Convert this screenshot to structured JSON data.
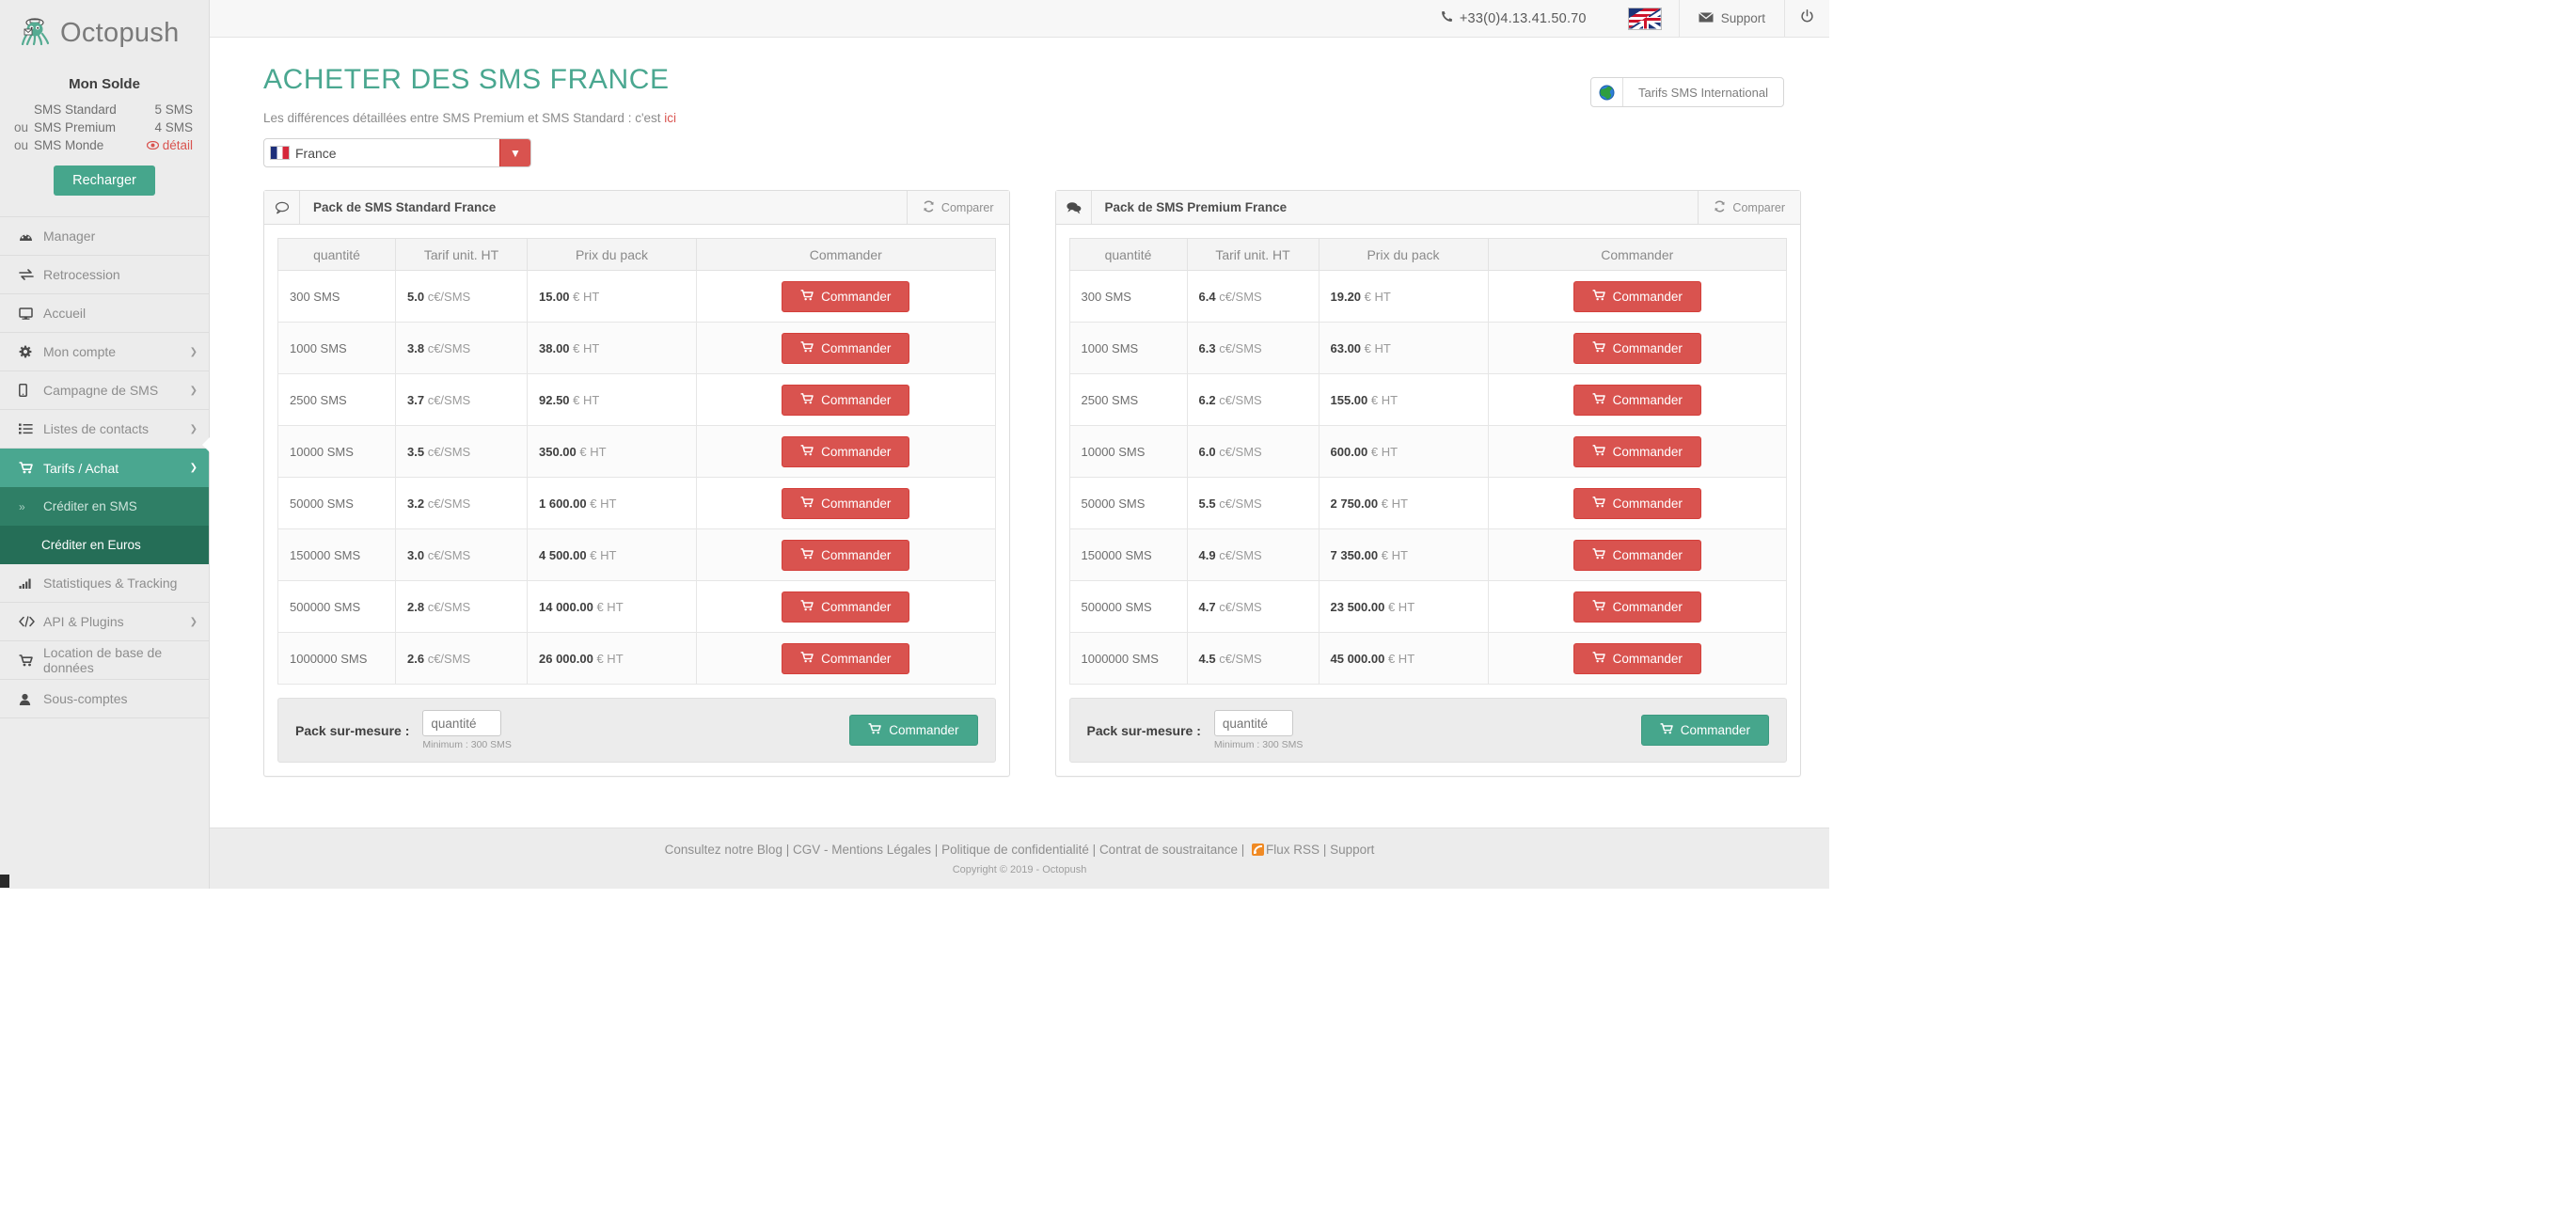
{
  "topbar": {
    "phone": "+33(0)4.13.41.50.70",
    "support_label": "Support",
    "phone_icon": "phone-icon",
    "flag_icon": "uk-us-flag-icon",
    "mail_icon": "mail-icon",
    "power_icon": "power-icon"
  },
  "brand": {
    "name": "Octopush",
    "logo_icon": "octopus-logo-icon"
  },
  "balance": {
    "title": "Mon Solde",
    "rows": [
      {
        "prefix": "",
        "label": "SMS Standard",
        "value": "5 SMS"
      },
      {
        "prefix": "ou",
        "label": "SMS Premium",
        "value": "4 SMS"
      },
      {
        "prefix": "ou",
        "label": "SMS Monde",
        "value": "détail"
      }
    ],
    "detail_label": "détail",
    "recharge_label": "Recharger"
  },
  "sidebar": {
    "items": [
      {
        "label": "Manager",
        "icon": "dashboard-icon",
        "caret": false
      },
      {
        "label": "Retrocession",
        "icon": "exchange-icon",
        "caret": false
      },
      {
        "label": "Accueil",
        "icon": "desktop-icon",
        "caret": false
      },
      {
        "label": "Mon compte",
        "icon": "gear-icon",
        "caret": true
      },
      {
        "label": "Campagne de SMS",
        "icon": "mobile-icon",
        "caret": true
      },
      {
        "label": "Listes de contacts",
        "icon": "list-icon",
        "caret": true
      },
      {
        "label": "Tarifs / Achat",
        "icon": "cart-icon",
        "caret": true,
        "active": true
      },
      {
        "label": "Statistiques & Tracking",
        "icon": "bar-chart-icon",
        "caret": false
      },
      {
        "label": "API & Plugins",
        "icon": "code-icon",
        "caret": true
      },
      {
        "label": "Location de base de données",
        "icon": "cart-icon",
        "caret": false
      },
      {
        "label": "Sous-comptes",
        "icon": "user-icon",
        "caret": false
      }
    ],
    "subitems": [
      {
        "label": "Créditer en SMS",
        "icon": "chevron-double-right-icon",
        "current": false
      },
      {
        "label": "Créditer en Euros",
        "icon": "",
        "current": true
      }
    ]
  },
  "header": {
    "title": "ACHETER DES SMS FRANCE",
    "subtitle_prefix": "Les différences détaillées entre SMS Premium et SMS Standard : c'est ",
    "subtitle_link": "ici",
    "international_button": "Tarifs SMS International",
    "globe_icon": "globe-icon"
  },
  "country_select": {
    "value": "France",
    "flag_icon": "france-flag-icon",
    "arrow_icon": "chevron-down-icon"
  },
  "panels": [
    {
      "icon": "speech-bubble-icon",
      "title": "Pack de SMS Standard France",
      "compare_label": "Comparer",
      "compare_icon": "refresh-icon",
      "columns": [
        "quantité",
        "Tarif unit. HT",
        "Prix du pack",
        "Commander"
      ],
      "order_label": "Commander",
      "cart_icon": "cart-icon",
      "rows": [
        {
          "qty": "300 SMS",
          "unit_value": "5.0",
          "unit_suffix": "c€/SMS",
          "price_value": "15.00",
          "price_suffix": "€ HT"
        },
        {
          "qty": "1000 SMS",
          "unit_value": "3.8",
          "unit_suffix": "c€/SMS",
          "price_value": "38.00",
          "price_suffix": "€ HT"
        },
        {
          "qty": "2500 SMS",
          "unit_value": "3.7",
          "unit_suffix": "c€/SMS",
          "price_value": "92.50",
          "price_suffix": "€ HT"
        },
        {
          "qty": "10000 SMS",
          "unit_value": "3.5",
          "unit_suffix": "c€/SMS",
          "price_value": "350.00",
          "price_suffix": "€ HT"
        },
        {
          "qty": "50000 SMS",
          "unit_value": "3.2",
          "unit_suffix": "c€/SMS",
          "price_value": "1 600.00",
          "price_suffix": "€ HT"
        },
        {
          "qty": "150000 SMS",
          "unit_value": "3.0",
          "unit_suffix": "c€/SMS",
          "price_value": "4 500.00",
          "price_suffix": "€ HT"
        },
        {
          "qty": "500000 SMS",
          "unit_value": "2.8",
          "unit_suffix": "c€/SMS",
          "price_value": "14 000.00",
          "price_suffix": "€ HT"
        },
        {
          "qty": "1000000 SMS",
          "unit_value": "2.6",
          "unit_suffix": "c€/SMS",
          "price_value": "26 000.00",
          "price_suffix": "€ HT"
        }
      ],
      "custom": {
        "label": "Pack sur-mesure :",
        "placeholder": "quantité",
        "minimum": "Minimum : 300 SMS",
        "order_label": "Commander"
      }
    },
    {
      "icon": "speech-bubbles-icon",
      "title": "Pack de SMS Premium France",
      "compare_label": "Comparer",
      "compare_icon": "refresh-icon",
      "columns": [
        "quantité",
        "Tarif unit. HT",
        "Prix du pack",
        "Commander"
      ],
      "order_label": "Commander",
      "cart_icon": "cart-icon",
      "rows": [
        {
          "qty": "300 SMS",
          "unit_value": "6.4",
          "unit_suffix": "c€/SMS",
          "price_value": "19.20",
          "price_suffix": "€ HT"
        },
        {
          "qty": "1000 SMS",
          "unit_value": "6.3",
          "unit_suffix": "c€/SMS",
          "price_value": "63.00",
          "price_suffix": "€ HT"
        },
        {
          "qty": "2500 SMS",
          "unit_value": "6.2",
          "unit_suffix": "c€/SMS",
          "price_value": "155.00",
          "price_suffix": "€ HT"
        },
        {
          "qty": "10000 SMS",
          "unit_value": "6.0",
          "unit_suffix": "c€/SMS",
          "price_value": "600.00",
          "price_suffix": "€ HT"
        },
        {
          "qty": "50000 SMS",
          "unit_value": "5.5",
          "unit_suffix": "c€/SMS",
          "price_value": "2 750.00",
          "price_suffix": "€ HT"
        },
        {
          "qty": "150000 SMS",
          "unit_value": "4.9",
          "unit_suffix": "c€/SMS",
          "price_value": "7 350.00",
          "price_suffix": "€ HT"
        },
        {
          "qty": "500000 SMS",
          "unit_value": "4.7",
          "unit_suffix": "c€/SMS",
          "price_value": "23 500.00",
          "price_suffix": "€ HT"
        },
        {
          "qty": "1000000 SMS",
          "unit_value": "4.5",
          "unit_suffix": "c€/SMS",
          "price_value": "45 000.00",
          "price_suffix": "€ HT"
        }
      ],
      "custom": {
        "label": "Pack sur-mesure :",
        "placeholder": "quantité",
        "minimum": "Minimum : 300 SMS",
        "order_label": "Commander"
      }
    }
  ],
  "footer": {
    "links": [
      "Consultez notre Blog",
      "CGV - Mentions Légales",
      "Politique de confidentialité",
      "Contrat de soustraitance",
      "Flux RSS",
      "Support"
    ],
    "copyright": "Copyright © 2019 - Octopush",
    "rss_icon": "rss-icon"
  },
  "colors": {
    "accent_green": "#4aa790",
    "danger_red": "#d9534f",
    "sidebar_bg": "#ececec",
    "submenu_bg": "#2f7f66",
    "submenu_current_bg": "#256e57"
  }
}
